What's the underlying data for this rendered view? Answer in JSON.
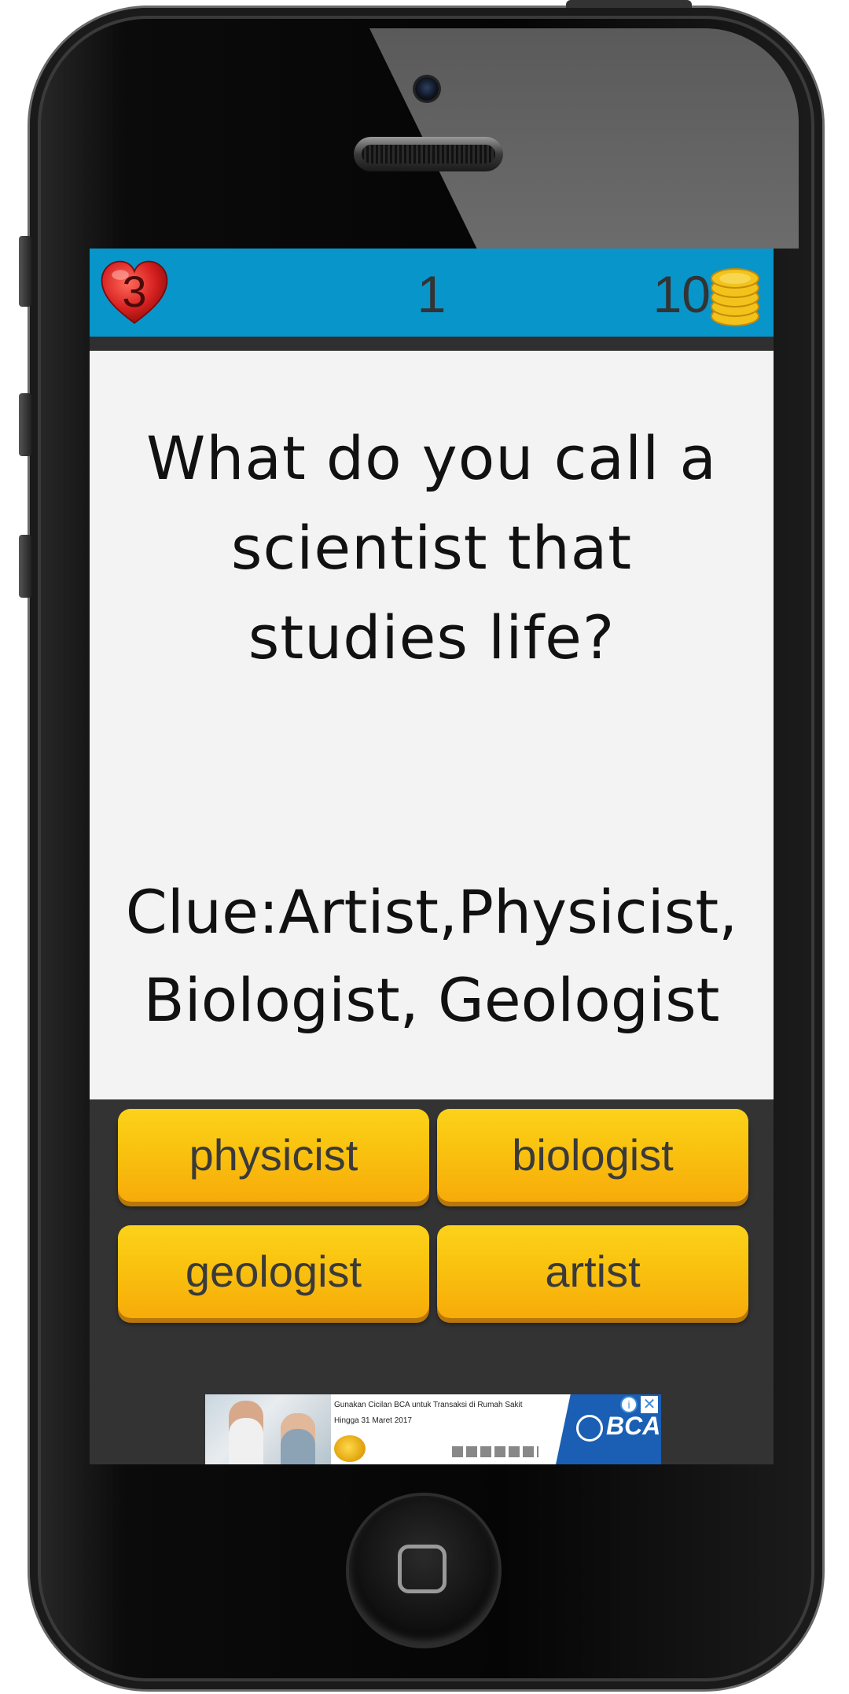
{
  "hud": {
    "lives": "3",
    "level": "1",
    "coins": "10"
  },
  "question": {
    "line1": "What do you call a",
    "line2": "scientist that",
    "line3": "studies life?"
  },
  "clue": {
    "line1": "Clue:Artist,Physicist,",
    "line2": "Biologist, Geologist"
  },
  "answers": [
    {
      "label": "physicist"
    },
    {
      "label": "biologist"
    },
    {
      "label": "geologist"
    },
    {
      "label": "artist"
    }
  ],
  "ad": {
    "line1": "Gunakan Cicilan BCA untuk Transaksi di Rumah Sakit",
    "line2": "Hingga 31 Maret 2017",
    "brand": "BCA",
    "info_glyph": "i",
    "close_glyph": "✕"
  },
  "colors": {
    "hud_bg": "#0895c9",
    "screen_bg": "#f3f3f3",
    "panel_bg": "#333333",
    "button": "#f9c20f",
    "heart": "#d62020",
    "coin": "#f2c31b"
  },
  "icons": [
    "heart-icon",
    "coins-icon",
    "info-icon",
    "close-icon"
  ]
}
